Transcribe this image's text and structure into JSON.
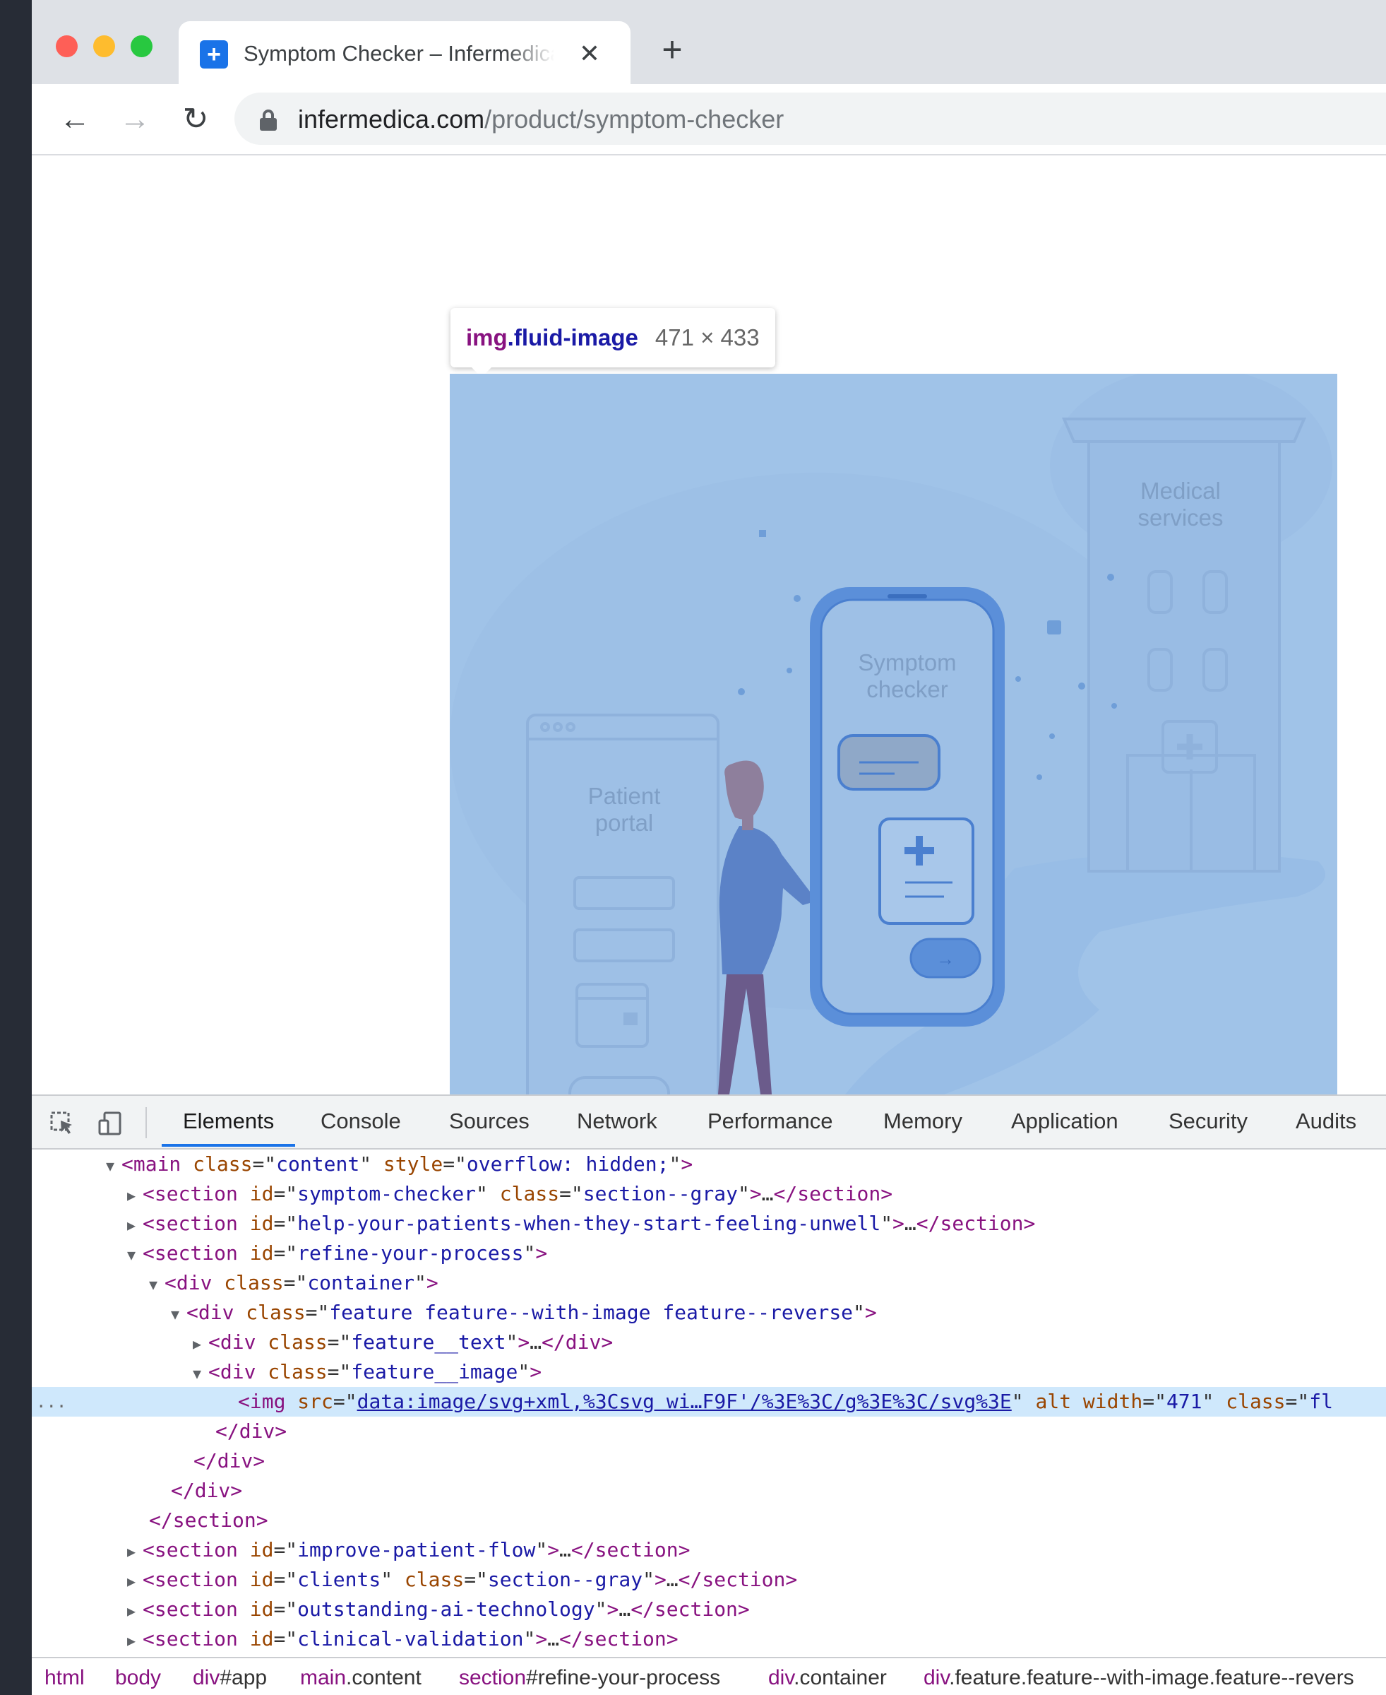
{
  "browser": {
    "tab_title": "Symptom Checker – Infermedica",
    "tab_favicon": "+",
    "tab_close": "✕",
    "new_tab": "+",
    "url_host": "infermedica.com",
    "url_path": "/product/symptom-checker",
    "icons": {
      "back": "back-arrow-icon",
      "forward": "forward-arrow-icon",
      "reload": "reload-icon",
      "lock": "lock-icon"
    }
  },
  "page": {
    "illustration_labels": {
      "medical_services_line1": "Medical",
      "medical_services_line2": "services",
      "symptom_checker_line1": "Symptom",
      "symptom_checker_line2": "checker",
      "patient_portal_line1": "Patient",
      "patient_portal_line2": "portal"
    }
  },
  "inspector_tooltip": {
    "tag": "img",
    "class_name": ".fluid-image",
    "size": "471 × 433"
  },
  "devtools": {
    "tabs": [
      "Elements",
      "Console",
      "Sources",
      "Network",
      "Performance",
      "Memory",
      "Application",
      "Security",
      "Audits"
    ],
    "active_tab": "Elements",
    "selected_line_gutter": "...",
    "dom": {
      "l1": {
        "tag": "main",
        "attrs": [
          [
            "class",
            "content"
          ],
          [
            "style",
            "overflow: hidden;"
          ]
        ]
      },
      "l2": {
        "tag": "section",
        "attrs": [
          [
            "id",
            "symptom-checker"
          ],
          [
            "class",
            "section--gray"
          ]
        ],
        "collapsed": "…"
      },
      "l3": {
        "tag": "section",
        "attrs": [
          [
            "id",
            "help-your-patients-when-they-start-feeling-unwell"
          ]
        ],
        "collapsed": "…"
      },
      "l4": {
        "tag": "section",
        "attrs": [
          [
            "id",
            "refine-your-process"
          ]
        ]
      },
      "l5": {
        "tag": "div",
        "attrs": [
          [
            "class",
            "container"
          ]
        ]
      },
      "l6": {
        "tag": "div",
        "attrs": [
          [
            "class",
            "feature feature--with-image feature--reverse"
          ]
        ]
      },
      "l7": {
        "tag": "div",
        "attrs": [
          [
            "class",
            "feature__text"
          ]
        ],
        "collapsed": "…"
      },
      "l8": {
        "tag": "div",
        "attrs": [
          [
            "class",
            "feature__image"
          ]
        ]
      },
      "l9": {
        "tag": "img",
        "src": "data:image/svg+xml,%3Csvg wi…F9F'/%3E%3C/g%3E%3C/svg%3E",
        "alt": "alt",
        "width_attr": "width",
        "width_val": "471",
        "class_attr": "class",
        "class_val": "fl"
      },
      "l10": "</div>",
      "l11": "</div>",
      "l12": "</div>",
      "l13": "</section>",
      "l14": {
        "tag": "section",
        "attrs": [
          [
            "id",
            "improve-patient-flow"
          ]
        ],
        "collapsed": "…"
      },
      "l15": {
        "tag": "section",
        "attrs": [
          [
            "id",
            "clients"
          ],
          [
            "class",
            "section--gray"
          ]
        ],
        "collapsed": "…"
      },
      "l16": {
        "tag": "section",
        "attrs": [
          [
            "id",
            "outstanding-ai-technology"
          ]
        ],
        "collapsed": "…"
      },
      "l17": {
        "tag": "section",
        "attrs": [
          [
            "id",
            "clinical-validation"
          ]
        ],
        "collapsed": "…"
      }
    },
    "breadcrumbs": [
      {
        "tag": "html",
        "rest": ""
      },
      {
        "tag": "body",
        "rest": ""
      },
      {
        "tag": "div",
        "rest": "#app"
      },
      {
        "tag": "main",
        "rest": ".content"
      },
      {
        "tag": "section",
        "rest": "#refine-your-process"
      },
      {
        "tag": "div",
        "rest": ".container"
      },
      {
        "tag": "div",
        "rest": ".feature.feature--with-image.feature--revers"
      }
    ]
  }
}
